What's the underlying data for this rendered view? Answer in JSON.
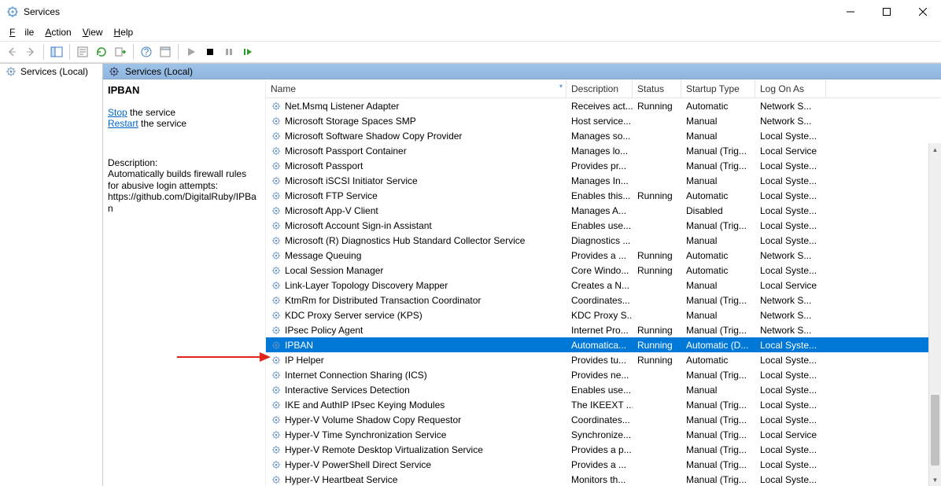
{
  "window": {
    "title": "Services"
  },
  "menu": {
    "file": "File",
    "action": "Action",
    "view": "View",
    "help": "Help"
  },
  "tree": {
    "root": "Services (Local)"
  },
  "panel": {
    "heading": "Services (Local)"
  },
  "detail": {
    "title": "IPBAN",
    "stop_label": "Stop",
    "stop_suffix": " the service",
    "restart_label": "Restart",
    "restart_suffix": " the service",
    "desc_label": "Description:",
    "desc_text": "Automatically builds firewall rules for abusive login attempts: https://github.com/DigitalRuby/IPBan"
  },
  "columns": {
    "name": "Name",
    "description": "Description",
    "status": "Status",
    "startup": "Startup Type",
    "logon": "Log On As"
  },
  "selected_index": 16,
  "services": [
    {
      "name": "Net.Msmq Listener Adapter",
      "desc": "Receives act...",
      "status": "Running",
      "startup": "Automatic",
      "logon": "Network S..."
    },
    {
      "name": "Microsoft Storage Spaces SMP",
      "desc": "Host service...",
      "status": "",
      "startup": "Manual",
      "logon": "Network S..."
    },
    {
      "name": "Microsoft Software Shadow Copy Provider",
      "desc": "Manages so...",
      "status": "",
      "startup": "Manual",
      "logon": "Local Syste..."
    },
    {
      "name": "Microsoft Passport Container",
      "desc": "Manages lo...",
      "status": "",
      "startup": "Manual (Trig...",
      "logon": "Local Service"
    },
    {
      "name": "Microsoft Passport",
      "desc": "Provides pr...",
      "status": "",
      "startup": "Manual (Trig...",
      "logon": "Local Syste..."
    },
    {
      "name": "Microsoft iSCSI Initiator Service",
      "desc": "Manages In...",
      "status": "",
      "startup": "Manual",
      "logon": "Local Syste..."
    },
    {
      "name": "Microsoft FTP Service",
      "desc": "Enables this...",
      "status": "Running",
      "startup": "Automatic",
      "logon": "Local Syste..."
    },
    {
      "name": "Microsoft App-V Client",
      "desc": "Manages A...",
      "status": "",
      "startup": "Disabled",
      "logon": "Local Syste..."
    },
    {
      "name": "Microsoft Account Sign-in Assistant",
      "desc": "Enables use...",
      "status": "",
      "startup": "Manual (Trig...",
      "logon": "Local Syste..."
    },
    {
      "name": "Microsoft (R) Diagnostics Hub Standard Collector Service",
      "desc": "Diagnostics ...",
      "status": "",
      "startup": "Manual",
      "logon": "Local Syste..."
    },
    {
      "name": "Message Queuing",
      "desc": "Provides a ...",
      "status": "Running",
      "startup": "Automatic",
      "logon": "Network S..."
    },
    {
      "name": "Local Session Manager",
      "desc": "Core Windo...",
      "status": "Running",
      "startup": "Automatic",
      "logon": "Local Syste..."
    },
    {
      "name": "Link-Layer Topology Discovery Mapper",
      "desc": "Creates a N...",
      "status": "",
      "startup": "Manual",
      "logon": "Local Service"
    },
    {
      "name": "KtmRm for Distributed Transaction Coordinator",
      "desc": "Coordinates...",
      "status": "",
      "startup": "Manual (Trig...",
      "logon": "Network S..."
    },
    {
      "name": "KDC Proxy Server service (KPS)",
      "desc": "KDC Proxy S...",
      "status": "",
      "startup": "Manual",
      "logon": "Network S..."
    },
    {
      "name": "IPsec Policy Agent",
      "desc": "Internet Pro...",
      "status": "Running",
      "startup": "Manual (Trig...",
      "logon": "Network S..."
    },
    {
      "name": "IPBAN",
      "desc": "Automatica...",
      "status": "Running",
      "startup": "Automatic (D...",
      "logon": "Local Syste..."
    },
    {
      "name": "IP Helper",
      "desc": "Provides tu...",
      "status": "Running",
      "startup": "Automatic",
      "logon": "Local Syste..."
    },
    {
      "name": "Internet Connection Sharing (ICS)",
      "desc": "Provides ne...",
      "status": "",
      "startup": "Manual (Trig...",
      "logon": "Local Syste..."
    },
    {
      "name": "Interactive Services Detection",
      "desc": "Enables use...",
      "status": "",
      "startup": "Manual",
      "logon": "Local Syste..."
    },
    {
      "name": "IKE and AuthIP IPsec Keying Modules",
      "desc": "The IKEEXT ...",
      "status": "",
      "startup": "Manual (Trig...",
      "logon": "Local Syste..."
    },
    {
      "name": "Hyper-V Volume Shadow Copy Requestor",
      "desc": "Coordinates...",
      "status": "",
      "startup": "Manual (Trig...",
      "logon": "Local Syste..."
    },
    {
      "name": "Hyper-V Time Synchronization Service",
      "desc": "Synchronize...",
      "status": "",
      "startup": "Manual (Trig...",
      "logon": "Local Service"
    },
    {
      "name": "Hyper-V Remote Desktop Virtualization Service",
      "desc": "Provides a p...",
      "status": "",
      "startup": "Manual (Trig...",
      "logon": "Local Syste..."
    },
    {
      "name": "Hyper-V PowerShell Direct Service",
      "desc": "Provides a ...",
      "status": "",
      "startup": "Manual (Trig...",
      "logon": "Local Syste..."
    },
    {
      "name": "Hyper-V Heartbeat Service",
      "desc": "Monitors th...",
      "status": "",
      "startup": "Manual (Trig...",
      "logon": "Local Syste..."
    }
  ]
}
